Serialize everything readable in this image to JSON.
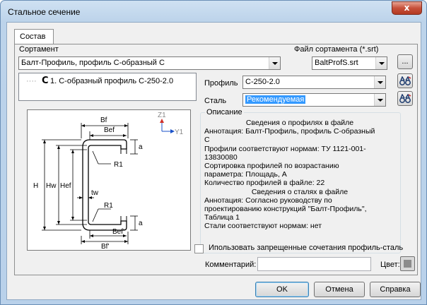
{
  "window": {
    "title": "Стальное сечение",
    "close_glyph": "x"
  },
  "tabs": [
    {
      "label": "Состав"
    }
  ],
  "sortament": {
    "label": "Сортамент",
    "value": "Балт-Профиль, профиль С-образный С",
    "file_label": "Файл сортамента (*.srt)",
    "file_value": "BaltProfS.srt",
    "browse_label": "..."
  },
  "tree": {
    "item_icon": "C",
    "item_label": "1. С-образный профиль С-250-2.0"
  },
  "profile": {
    "label": "Профиль",
    "value": "С-250-2.0"
  },
  "steel": {
    "label": "Сталь",
    "value": "Рекомендуемая"
  },
  "drawing": {
    "dims": {
      "bf": "Bf",
      "bef": "Bef",
      "a": "a",
      "r1": "R1",
      "tw": "tw",
      "h": "H",
      "hw": "Hw",
      "hef": "Hef",
      "bef_prime": "Bef'",
      "bf_prime": "Bf'"
    },
    "axes": {
      "z": "Z1",
      "y": "Y1"
    }
  },
  "description": {
    "label": "Описание",
    "lines": [
      {
        "text": "Сведения о профилях в файле",
        "center": true
      },
      {
        "text": "Аннотация: Балт-Профиль, профиль С-образный",
        "center": false
      },
      {
        "text": "С",
        "center": false
      },
      {
        "text": "Профили соответствуют нормам: ТУ 1121-001-",
        "center": false
      },
      {
        "text": "13830080",
        "center": false
      },
      {
        "text": "Сортировка профилей по возрастанию",
        "center": false
      },
      {
        "text": "параметра: Площадь, А",
        "center": false
      },
      {
        "text": "Количество профилей в файле: 22",
        "center": false
      },
      {
        "text": "Сведения о сталях в файле",
        "center": true
      },
      {
        "text": "Аннотация: Согласно руководству по",
        "center": false
      },
      {
        "text": "проектированию конструкций \"Балт-Профиль\",",
        "center": false
      },
      {
        "text": "Таблица 1",
        "center": false
      },
      {
        "text": "Стали соответствуют нормам: нет",
        "center": false
      }
    ]
  },
  "forbidden_checkbox": {
    "label": "Ипользовать запрещенные сочетания профиль-сталь",
    "checked": false
  },
  "comment": {
    "label": "Комментарий:",
    "value": ""
  },
  "color": {
    "label": "Цвет:"
  },
  "buttons": {
    "ok": "OK",
    "cancel": "Отмена",
    "help": "Справка"
  }
}
